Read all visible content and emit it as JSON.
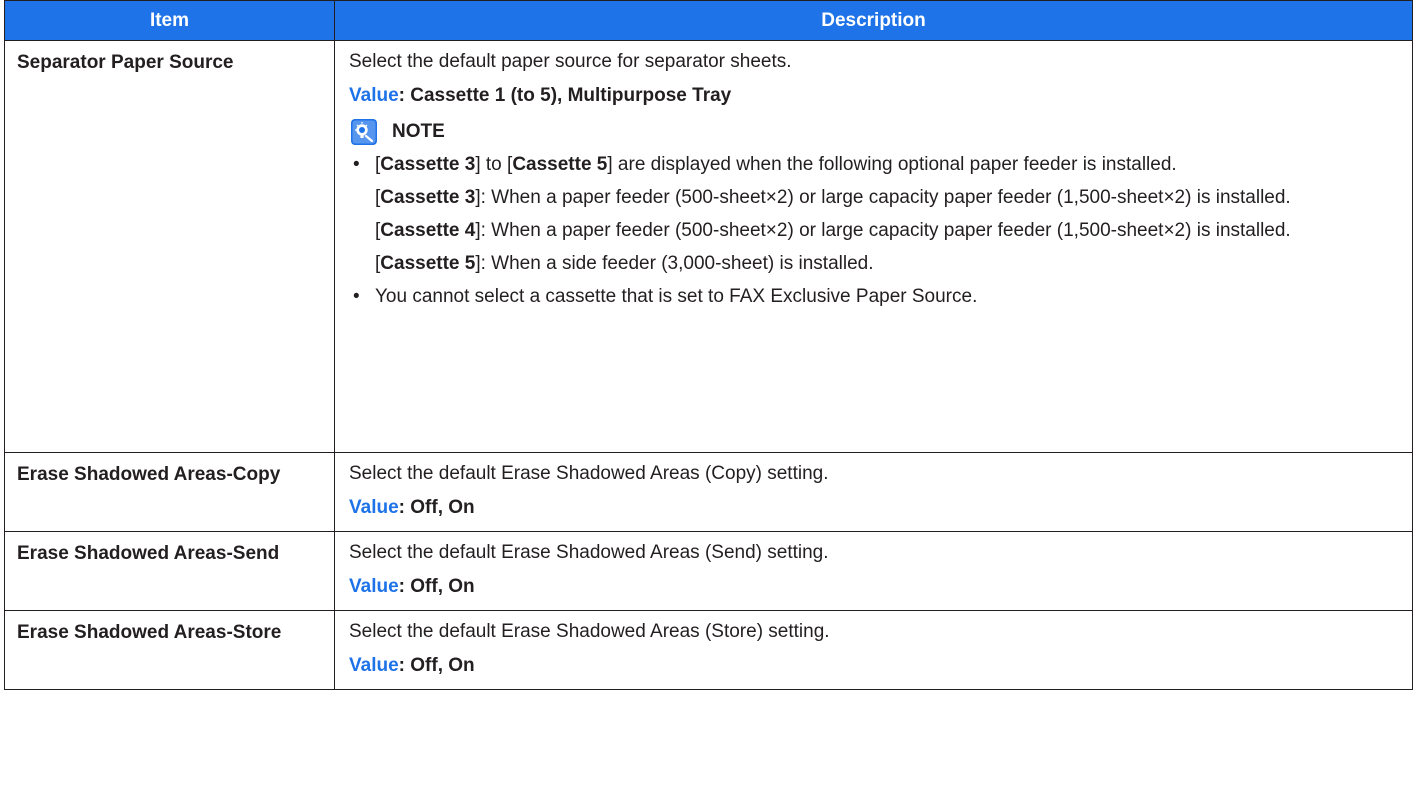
{
  "header": {
    "item": "Item",
    "description": "Description"
  },
  "rows": [
    {
      "item": "Separator Paper Source",
      "description": "Select the default paper source for separator sheets.",
      "value_label": "Value",
      "value_text": ": Cassette 1 (to 5), Multipurpose Tray",
      "note": {
        "title": "NOTE",
        "icon": "note-icon",
        "b1": {
          "o1": "[",
          "k1": "Cassette 3",
          "m": "] to [",
          "k2": "Cassette 5",
          "rest": "] are displayed when the following optional paper feeder is installed."
        },
        "sub1": {
          "o": "[",
          "k": "Cassette 3",
          "rest": "]: When a paper feeder (500-sheet×2) or large capacity paper feeder (1,500-sheet×2) is installed."
        },
        "sub2": {
          "o": "[",
          "k": "Cassette 4",
          "rest": "]: When a paper feeder (500-sheet×2) or large capacity paper feeder (1,500-sheet×2) is installed."
        },
        "sub3": {
          "o": "[",
          "k": "Cassette 5",
          "rest": "]: When a side feeder (3,000-sheet) is installed."
        },
        "b2": "You cannot select a cassette that is set to FAX Exclusive Paper Source."
      }
    },
    {
      "item": "Erase Shadowed Areas-Copy",
      "description": "Select the default Erase Shadowed Areas (Copy) setting.",
      "value_label": "Value",
      "value_text": ": Off, On"
    },
    {
      "item": "Erase Shadowed Areas-Send",
      "description": "Select the default Erase Shadowed Areas (Send) setting.",
      "value_label": "Value",
      "value_text": ": Off, On"
    },
    {
      "item": "Erase Shadowed Areas-Store",
      "description": "Select the default Erase Shadowed Areas (Store) setting.",
      "value_label": "Value",
      "value_text": ": Off, On"
    }
  ],
  "colors": {
    "header_bg": "#1e73e8",
    "value_label": "#1e73e8",
    "border": "#231f20"
  }
}
